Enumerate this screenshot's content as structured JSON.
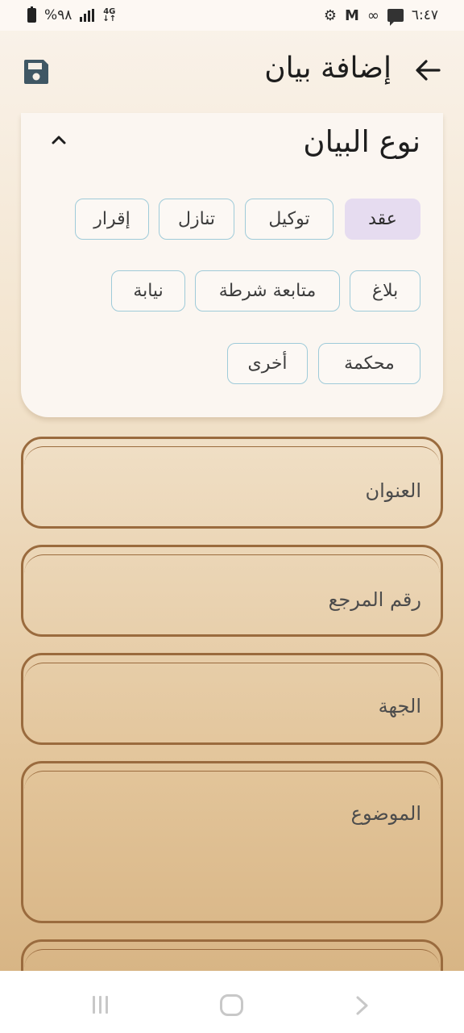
{
  "status_bar": {
    "time": "٦:٤٧",
    "battery": "%٩٨",
    "network": "4G",
    "icons": [
      "battery-icon",
      "signal-icon",
      "network-4g-icon",
      "chat-icon",
      "infinity-icon",
      "gmail-icon",
      "notification-icon"
    ]
  },
  "app_bar": {
    "title": "إضافة بيان",
    "back_icon": "arrow-back-icon",
    "save_icon": "save-icon"
  },
  "statement_type": {
    "title": "نوع البيان",
    "expanded": true,
    "options": [
      {
        "label": "عقد",
        "selected": true
      },
      {
        "label": "توكيل",
        "selected": false
      },
      {
        "label": "تنازل",
        "selected": false
      },
      {
        "label": "إقرار",
        "selected": false
      },
      {
        "label": "بلاغ",
        "selected": false
      },
      {
        "label": "متابعة شرطة",
        "selected": false
      },
      {
        "label": "نيابة",
        "selected": false
      },
      {
        "label": "محكمة",
        "selected": false
      },
      {
        "label": "أخرى",
        "selected": false
      }
    ]
  },
  "fields": {
    "title": {
      "label": "العنوان",
      "value": ""
    },
    "reference_number": {
      "label": "رقم المرجع",
      "value": ""
    },
    "entity": {
      "label": "الجهة",
      "value": ""
    },
    "subject": {
      "label": "الموضوع",
      "value": ""
    }
  },
  "colors": {
    "selected_chip": "#e6dcf0",
    "chip_border": "#9fcbd9",
    "field_border": "#9a6b3e",
    "background_top": "#faf3eb",
    "background_bottom": "#d8b585"
  }
}
